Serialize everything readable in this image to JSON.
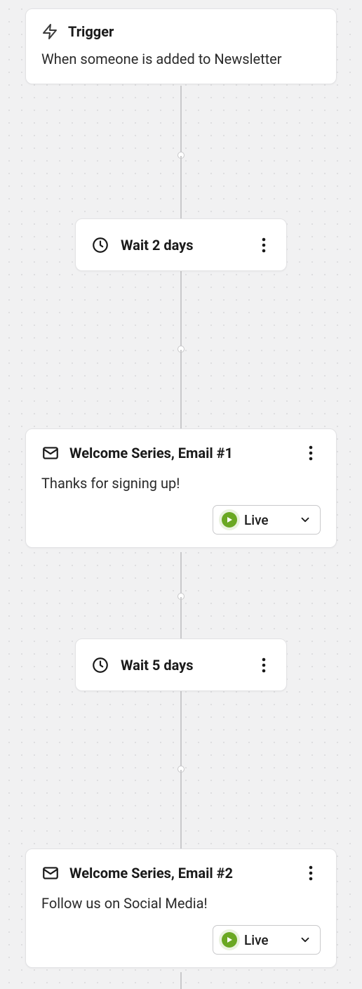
{
  "trigger": {
    "title": "Trigger",
    "description": "When someone is added to Newsletter"
  },
  "steps": [
    {
      "type": "wait",
      "label": "Wait 2 days"
    },
    {
      "type": "email",
      "title": "Welcome Series, Email #1",
      "description": "Thanks for signing up!",
      "status": "Live"
    },
    {
      "type": "wait",
      "label": "Wait 5 days"
    },
    {
      "type": "email",
      "title": "Welcome Series, Email #2",
      "description": "Follow us on Social Media!",
      "status": "Live"
    }
  ]
}
